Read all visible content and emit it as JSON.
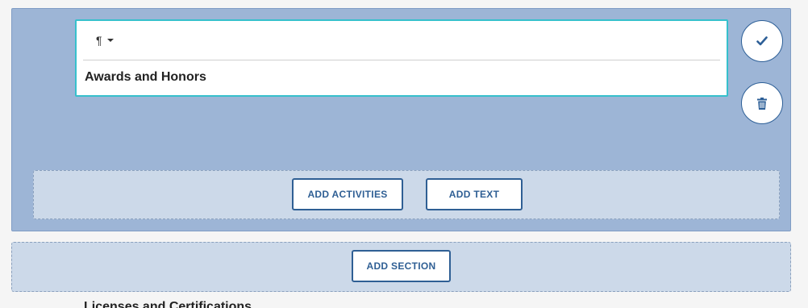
{
  "editor": {
    "format_label": "¶",
    "content_text": "Awards and Honors"
  },
  "actions": {
    "confirm_icon": "checkmark-icon",
    "delete_icon": "trash-icon"
  },
  "inner_add_bar": {
    "add_activities_label": "ADD ACTIVITIES",
    "add_text_label": "ADD TEXT"
  },
  "outer_add_bar": {
    "add_section_label": "ADD SECTION"
  },
  "next_section": {
    "heading": "Licenses and Certifications"
  },
  "colors": {
    "panel_bg": "#9db5d6",
    "editor_border": "#36c0cc",
    "button_text": "#2f5f94",
    "add_bar_bg": "#ccd9e9"
  }
}
